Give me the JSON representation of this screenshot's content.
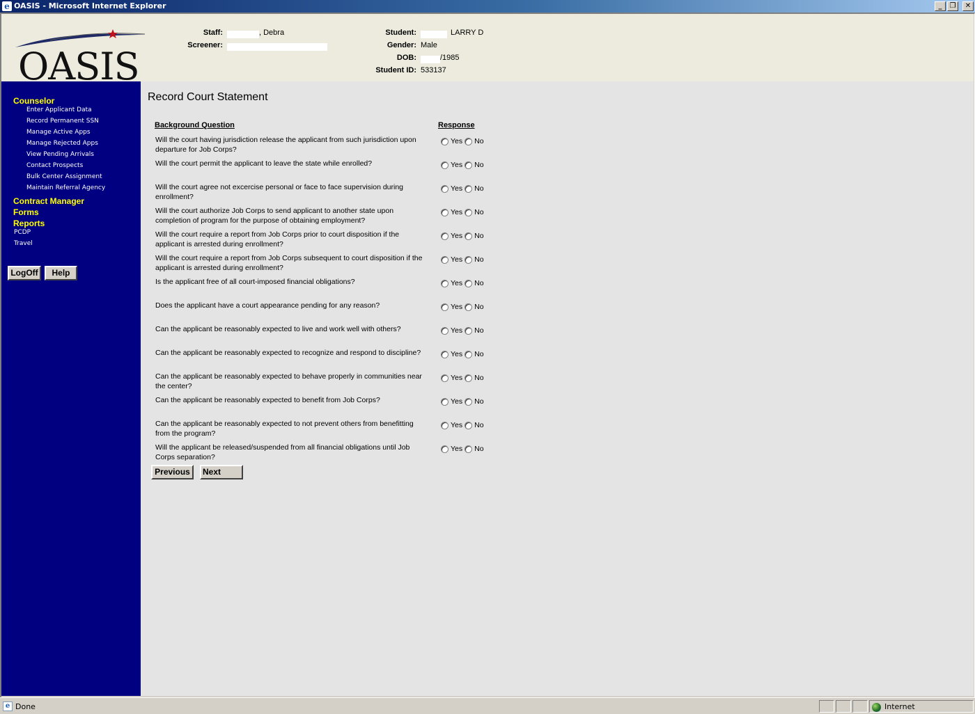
{
  "window": {
    "title": "OASIS - Microsoft Internet Explorer",
    "minimize": "_",
    "restore": "❐",
    "close": "✕"
  },
  "header": {
    "logo_text": "OASIS",
    "staff_label": "Staff:",
    "staff_value": ", Debra",
    "screener_label": "Screener:",
    "student_label": "Student:",
    "student_value": "LARRY D",
    "gender_label": "Gender:",
    "gender_value": "Male",
    "dob_label": "DOB:",
    "dob_value": "/1985",
    "student_id_label": "Student ID:",
    "student_id_value": "533137"
  },
  "sidebar": {
    "counselor": "Counselor",
    "counselor_items": [
      "Enter Applicant Data",
      "Record Permanent SSN",
      "Manage Active Apps",
      "Manage Rejected Apps",
      "View Pending Arrivals",
      "Contact Prospects",
      "Bulk Center Assignment",
      "Maintain Referral Agency"
    ],
    "contract_manager": "Contract Manager",
    "forms": "Forms",
    "reports": "Reports",
    "reports_items": [
      "PCDP",
      "Travel"
    ],
    "logoff": "LogOff",
    "help": "Help"
  },
  "main": {
    "title": "Record Court Statement",
    "col_question": "Background Question",
    "col_response": "Response",
    "yes_label": "Yes",
    "no_label": "No",
    "questions": [
      "Will the court having jurisdiction release the applicant from such jurisdiction upon departure for Job Corps?",
      "Will the court permit the applicant to leave the state while enrolled?",
      "Will the court agree not excercise personal or face to face supervision during enrollment?",
      "Will the court authorize Job Corps to send applicant to another state upon completion of program for the purpose of obtaining employment?",
      "Will the court require a report from Job Corps prior to court disposition if the applicant is arrested during enrollment?",
      "Will the court require a report from Job Corps subsequent to court disposition if the applicant is arrested during enrollment?",
      "Is the applicant free of all court-imposed financial obligations?",
      "Does the applicant have a court appearance pending for any reason?",
      "Can the applicant be reasonably expected to live and work well with others?",
      "Can the applicant be reasonably expected to recognize and respond to discipline?",
      "Can the applicant be reasonably expected to behave properly in communities near the center?",
      "Can the applicant be reasonably expected to benefit from Job Corps?",
      "Can the applicant be reasonably expected to not prevent others from benefitting from the program?",
      "Will the applicant be released/suspended from all financial obligations until Job Corps separation?"
    ],
    "previous": "Previous",
    "next": "Next"
  },
  "statusbar": {
    "status": "Done",
    "zone": "Internet"
  }
}
